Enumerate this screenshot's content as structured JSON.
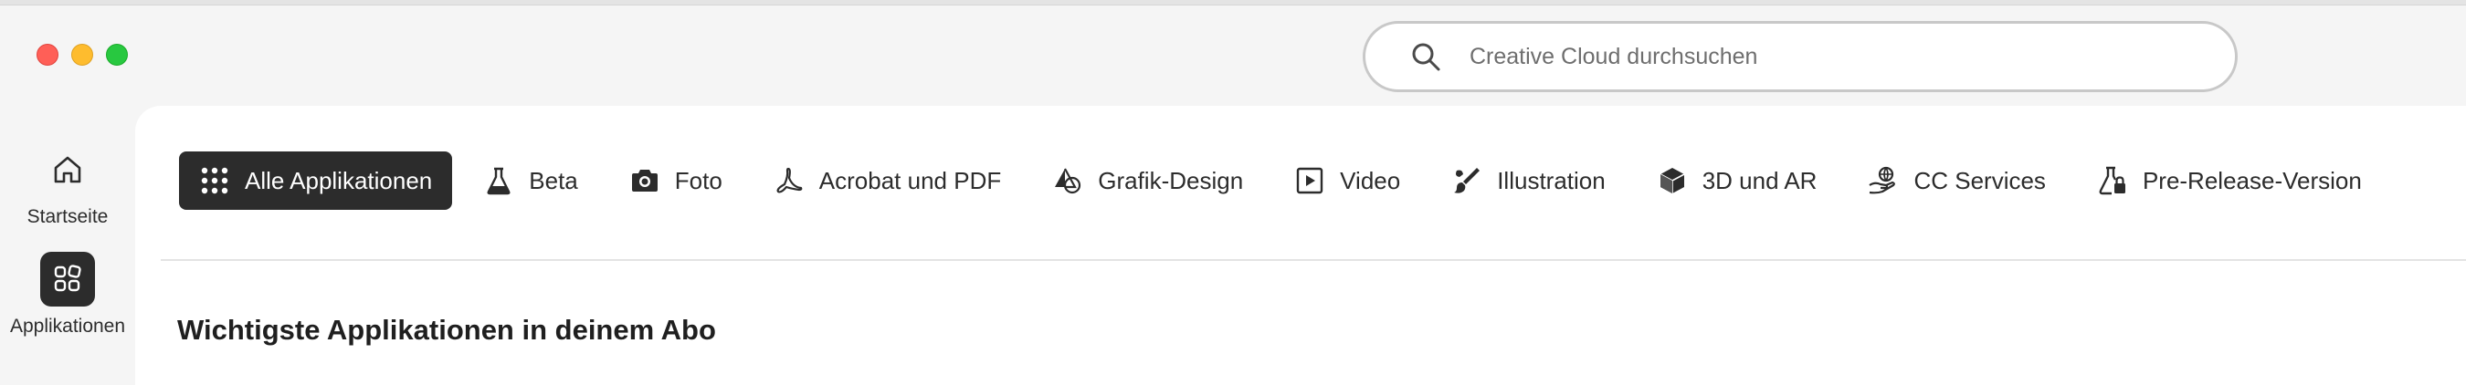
{
  "search": {
    "placeholder": "Creative Cloud durchsuchen"
  },
  "sidebar": {
    "items": [
      {
        "label": "Startseite",
        "icon": "home-icon",
        "active": false
      },
      {
        "label": "Applikationen",
        "icon": "apps-icon",
        "active": true
      }
    ]
  },
  "filters": [
    {
      "label": "Alle Applikationen",
      "icon": "grid-icon",
      "active": true
    },
    {
      "label": "Beta",
      "icon": "beaker-icon",
      "active": false
    },
    {
      "label": "Foto",
      "icon": "camera-icon",
      "active": false
    },
    {
      "label": "Acrobat und PDF",
      "icon": "acrobat-icon",
      "active": false
    },
    {
      "label": "Grafik-Design",
      "icon": "shapes-icon",
      "active": false
    },
    {
      "label": "Video",
      "icon": "video-icon",
      "active": false
    },
    {
      "label": "Illustration",
      "icon": "brush-icon",
      "active": false
    },
    {
      "label": "3D und AR",
      "icon": "cube-icon",
      "active": false
    },
    {
      "label": "CC Services",
      "icon": "services-icon",
      "active": false
    },
    {
      "label": "Pre-Release-Version",
      "icon": "prerelease-icon",
      "active": false
    }
  ],
  "main": {
    "section_title": "Wichtigste Applikationen in deinem Abo"
  },
  "colors": {
    "active_bg": "#2c2c2c",
    "content_bg": "#ffffff",
    "window_bg": "#f5f5f5"
  }
}
